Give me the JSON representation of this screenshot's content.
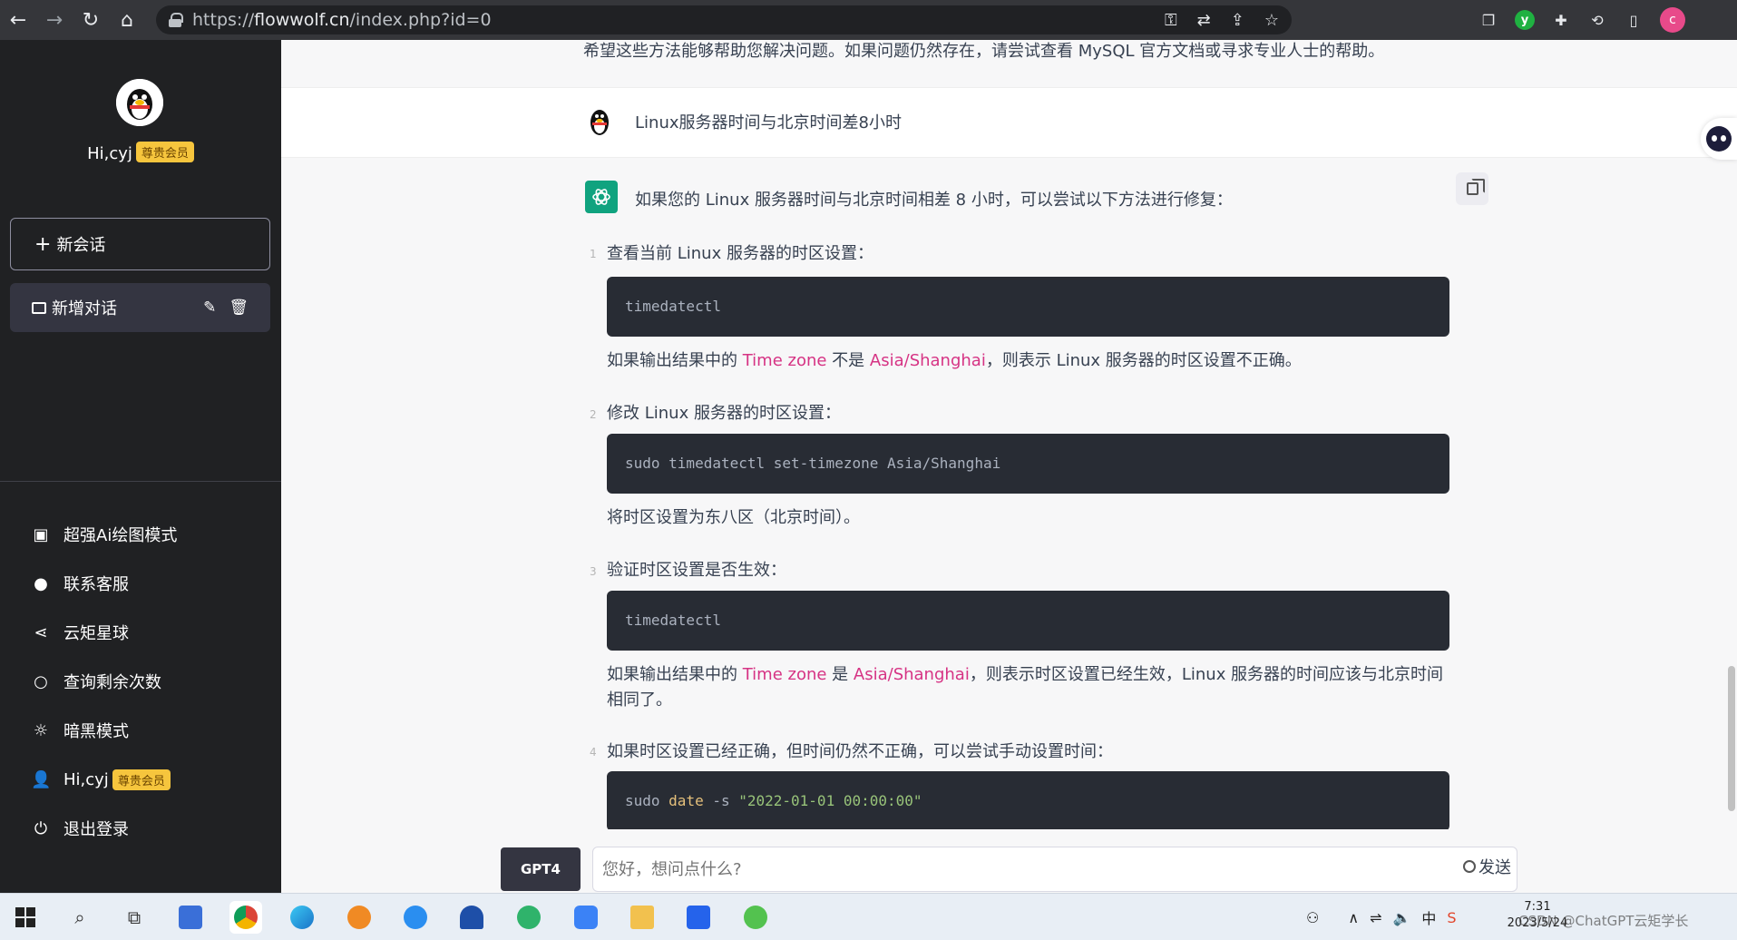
{
  "browser": {
    "url_scheme": "https://",
    "url_host": "flowwolf.cn",
    "url_path": "/index.php?id=0",
    "profile_initial": "c"
  },
  "sidebar": {
    "greeting": "Hi,cyj",
    "badge": "尊贵会员",
    "new_chat": "新会话",
    "chat_item": "新增对话",
    "menu": [
      {
        "label": "超强Ai绘图模式",
        "icon": "image-icon"
      },
      {
        "label": "联系客服",
        "icon": "wechat-icon"
      },
      {
        "label": "云矩星球",
        "icon": "share-icon"
      },
      {
        "label": "查询剩余次数",
        "icon": "search-icon"
      },
      {
        "label": "暗黑模式",
        "icon": "sun-icon"
      },
      {
        "label": "Hi,cyj",
        "icon": "user-icon",
        "badge": "尊贵会员"
      },
      {
        "label": "退出登录",
        "icon": "power-icon"
      }
    ]
  },
  "chat": {
    "prev_tail": "希望这些方法能够帮助您解决问题。如果问题仍然存在，请尝试查看 MySQL 官方文档或寻求专业人士的帮助。",
    "question": "Linux服务器时间与北京时间差8小时",
    "answer_intro": "如果您的 Linux 服务器时间与北京时间相差 8 小时，可以尝试以下方法进行修复：",
    "steps": [
      {
        "num": "1",
        "title": "查看当前 Linux 服务器的时区设置：",
        "code": "timedatectl",
        "note_pre": "如果输出结果中的 ",
        "note_hl1": "Time zone",
        "note_mid": " 不是 ",
        "note_hl2": "Asia/Shanghai",
        "note_post": "，则表示 Linux 服务器的时区设置不正确。"
      },
      {
        "num": "2",
        "title": "修改 Linux 服务器的时区设置：",
        "code": "sudo timedatectl set-timezone Asia/Shanghai",
        "note": "将时区设置为东八区（北京时间）。"
      },
      {
        "num": "3",
        "title": "验证时区设置是否生效：",
        "code": "timedatectl",
        "note_pre": "如果输出结果中的 ",
        "note_hl1": "Time zone",
        "note_mid": " 是 ",
        "note_hl2": "Asia/Shanghai",
        "note_post": "，则表示时区设置已经生效，Linux 服务器的时间应该与北京时间相同了。"
      },
      {
        "num": "4",
        "title": "如果时区设置已经正确，但时间仍然不正确，可以尝试手动设置时间：",
        "code_kw1": "sudo ",
        "code_cmd": "date",
        "code_flag": " -s ",
        "code_str": "\"2022-01-01 00:00:00\""
      }
    ]
  },
  "input": {
    "model": "GPT4",
    "placeholder": "您好，想问点什么?",
    "send": "发送"
  },
  "taskbar": {
    "time": "7:31",
    "date": "2023/5/24",
    "watermark": "CSDN @ChatGPT云矩学长"
  }
}
